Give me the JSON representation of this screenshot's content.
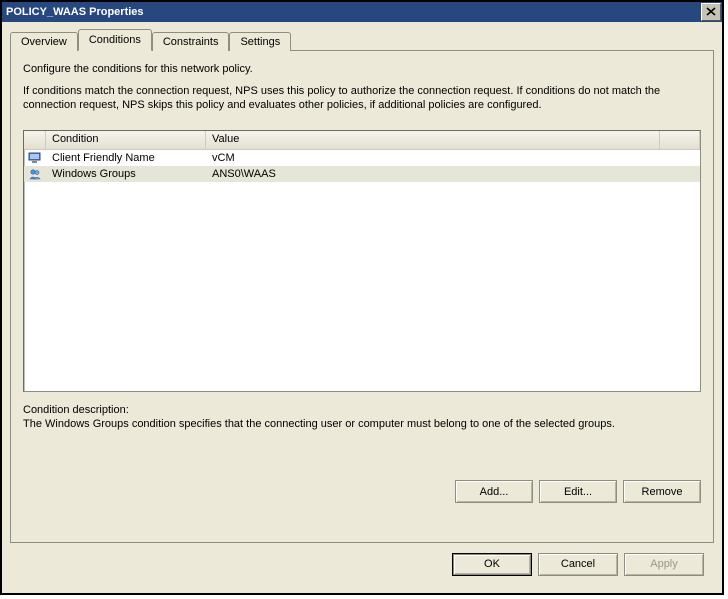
{
  "window": {
    "title": "POLICY_WAAS Properties",
    "close_glyph": "✕"
  },
  "tabs": {
    "overview": "Overview",
    "conditions": "Conditions",
    "constraints": "Constraints",
    "settings": "Settings",
    "active": "conditions"
  },
  "intro": {
    "line1": "Configure the conditions for this network policy.",
    "line2": "If conditions match the connection request, NPS uses this policy to authorize the connection request. If conditions do not match the connection request, NPS skips this policy and evaluates other policies, if additional policies are configured."
  },
  "list": {
    "headers": {
      "condition": "Condition",
      "value": "Value"
    },
    "rows": [
      {
        "icon": "monitor-icon",
        "condition": "Client Friendly Name",
        "value": "vCM",
        "selected": false
      },
      {
        "icon": "group-icon",
        "condition": "Windows Groups",
        "value": "ANS0\\WAAS",
        "selected": true
      }
    ]
  },
  "description": {
    "label": "Condition description:",
    "text": "The Windows Groups condition specifies that the connecting user or computer must belong to one of the selected groups."
  },
  "buttons": {
    "add": "Add...",
    "edit": "Edit...",
    "remove": "Remove",
    "ok": "OK",
    "cancel": "Cancel",
    "apply": "Apply"
  }
}
